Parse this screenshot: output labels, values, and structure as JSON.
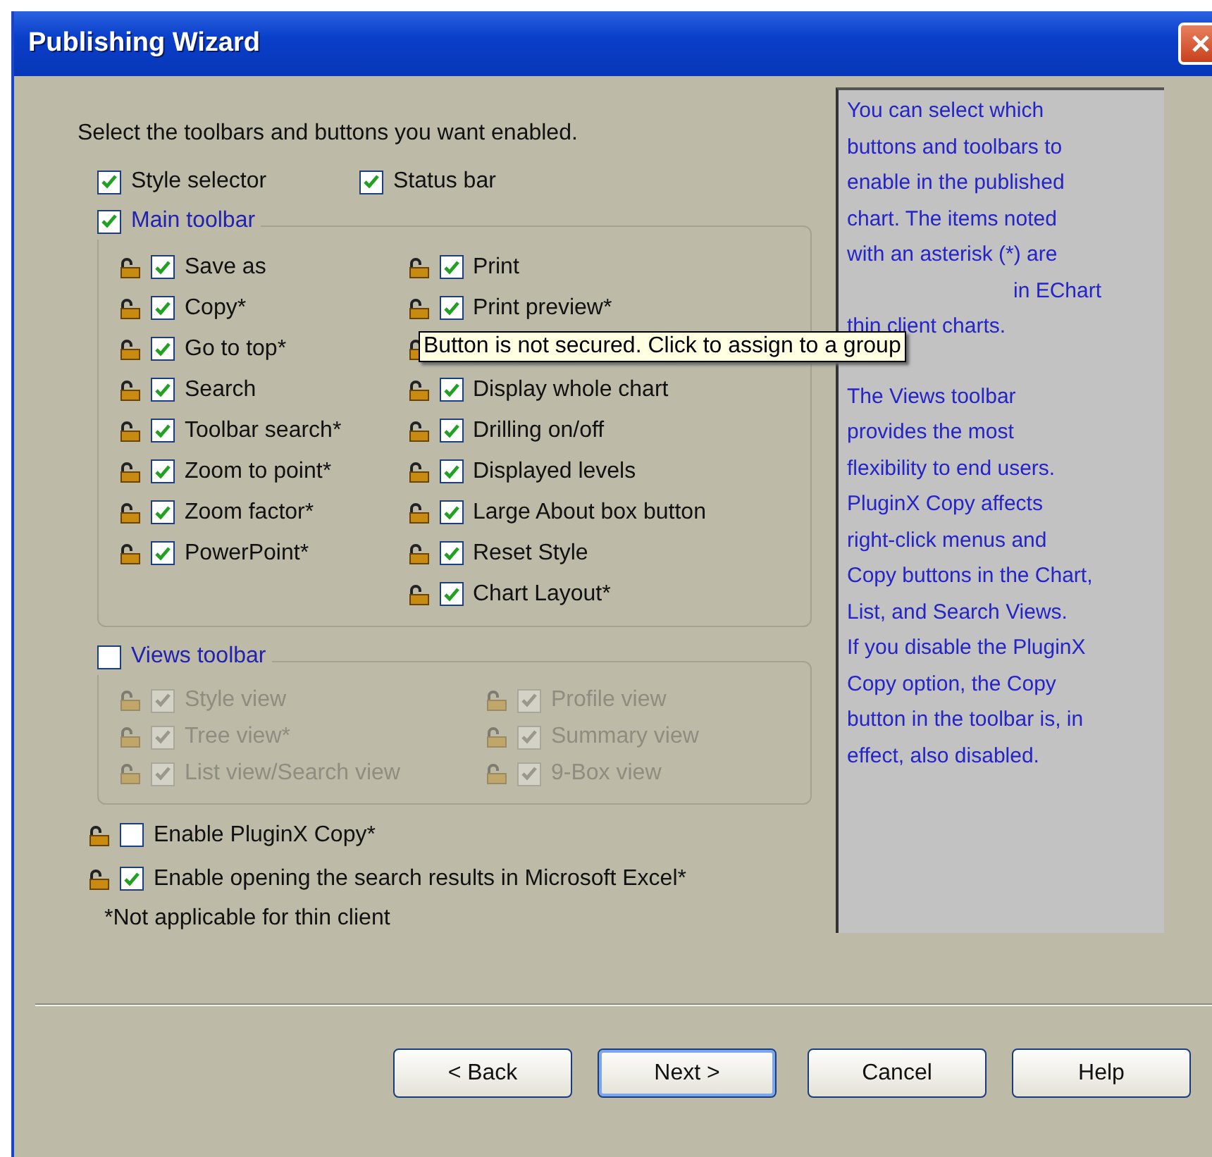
{
  "window": {
    "title": "Publishing Wizard"
  },
  "instruction": "Select the toolbars and buttons you want enabled.",
  "top_options": [
    {
      "label": "Style selector",
      "checked": true
    },
    {
      "label": "Status bar",
      "checked": true
    }
  ],
  "main_toolbar": {
    "label": "Main toolbar",
    "checked": true,
    "disabled": false,
    "left": [
      {
        "kind": "item",
        "label": "Save as",
        "checked": true
      },
      {
        "kind": "item",
        "label": "Copy*",
        "checked": true
      },
      {
        "kind": "item",
        "label": "Go to top*",
        "checked": true
      },
      {
        "kind": "item",
        "label": "Search",
        "checked": true
      },
      {
        "kind": "item",
        "label": "Toolbar search*",
        "checked": true
      },
      {
        "kind": "item",
        "label": "Zoom to point*",
        "checked": true
      },
      {
        "kind": "item",
        "label": "Zoom factor*",
        "checked": true
      },
      {
        "kind": "item",
        "label": "PowerPoint*",
        "checked": true
      }
    ],
    "right": [
      {
        "kind": "item",
        "label": "Print",
        "checked": true
      },
      {
        "kind": "item",
        "label": "Print preview*",
        "checked": true
      },
      {
        "kind": "covered"
      },
      {
        "kind": "item",
        "label": "Display whole chart",
        "checked": true
      },
      {
        "kind": "item",
        "label": "Drilling on/off",
        "checked": true
      },
      {
        "kind": "item",
        "label": "Displayed levels",
        "checked": true
      },
      {
        "kind": "item",
        "label": "Large About box button",
        "checked": true
      },
      {
        "kind": "item",
        "label": "Reset Style",
        "checked": true
      },
      {
        "kind": "item",
        "label": "Chart Layout*",
        "checked": true
      }
    ]
  },
  "views_toolbar": {
    "label": "Views toolbar",
    "checked": false,
    "disabled": true,
    "left": [
      {
        "kind": "item",
        "label": "Style view",
        "checked": true
      },
      {
        "kind": "item",
        "label": "Tree view*",
        "checked": true
      },
      {
        "kind": "item",
        "label": "List view/Search view",
        "checked": true
      }
    ],
    "right": [
      {
        "kind": "item",
        "label": "Profile view",
        "checked": true
      },
      {
        "kind": "item",
        "label": "Summary view",
        "checked": true
      },
      {
        "kind": "item",
        "label": "9-Box view",
        "checked": true
      }
    ]
  },
  "bottom_options": [
    {
      "label": "Enable PluginX Copy*",
      "checked": false
    },
    {
      "label": "Enable opening the search results in Microsoft Excel*",
      "checked": true
    }
  ],
  "footnote": "*Not applicable for thin client",
  "tooltip": {
    "text": "Button is not secured.  Click to assign to a group"
  },
  "help": {
    "paragraphs": [
      [
        {
          "kind": "line",
          "text": "You can select which"
        },
        {
          "kind": "line",
          "text": "buttons and toolbars to"
        },
        {
          "kind": "line",
          "text": "enable in the published"
        },
        {
          "kind": "line",
          "text": "chart. The items noted"
        },
        {
          "kind": "line",
          "text": "with an asterisk (*) are"
        },
        {
          "kind": "tail",
          "text": "in EChart"
        },
        {
          "kind": "line",
          "text": "thin client charts."
        }
      ],
      [
        {
          "kind": "line",
          "text": "The Views toolbar"
        },
        {
          "kind": "line",
          "text": "provides the most"
        },
        {
          "kind": "line",
          "text": "flexibility to end users."
        },
        {
          "kind": "line",
          "text": "PluginX Copy affects"
        },
        {
          "kind": "line",
          "text": "right-click menus and"
        },
        {
          "kind": "line",
          "text": "Copy buttons in the Chart,"
        },
        {
          "kind": "line",
          "text": "List, and Search Views."
        },
        {
          "kind": "line",
          "text": "If you disable the PluginX"
        },
        {
          "kind": "line",
          "text": "Copy option, the Copy"
        },
        {
          "kind": "line",
          "text": "button in the toolbar is, in"
        },
        {
          "kind": "line",
          "text": "effect, also disabled."
        }
      ]
    ]
  },
  "buttons": [
    {
      "label": "< Back",
      "default": false
    },
    {
      "label": "Next >",
      "default": true
    },
    {
      "label": "Cancel",
      "default": false
    },
    {
      "label": "Help",
      "default": false
    }
  ]
}
